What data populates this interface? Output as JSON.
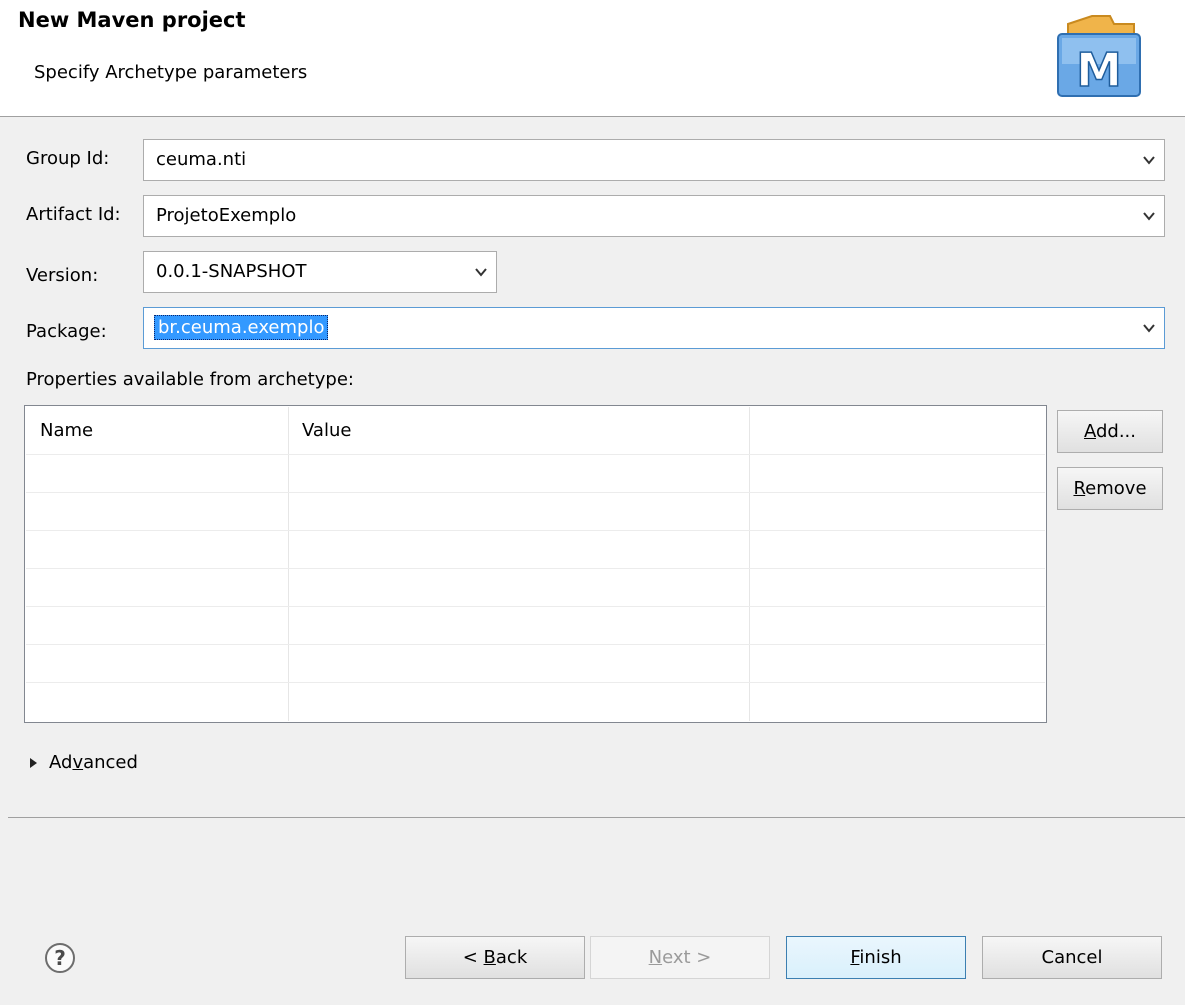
{
  "header": {
    "title": "New Maven project",
    "subtitle": "Specify Archetype parameters",
    "logo_letter": "M"
  },
  "form": {
    "group_id_label": "Group Id:",
    "group_id_value": "ceuma.nti",
    "artifact_id_label": "Artifact Id:",
    "artifact_id_value": "ProjetoExemplo",
    "version_label": "Version:",
    "version_value": "0.0.1-SNAPSHOT",
    "package_label": "Package:",
    "package_value": "br.ceuma.exemplo"
  },
  "properties": {
    "label": "Properties available from archetype:",
    "columns": [
      "Name",
      "Value",
      ""
    ],
    "rows": []
  },
  "side_buttons": {
    "add_mnemonic": "A",
    "add_rest": "dd...",
    "remove_mnemonic": "R",
    "remove_rest": "emove"
  },
  "advanced": {
    "pre": "Ad",
    "mnemonic": "v",
    "post": "anced"
  },
  "footer": {
    "back_pre": "< ",
    "back_mnemonic": "B",
    "back_post": "ack",
    "next_mnemonic": "N",
    "next_post": "ext >",
    "finish_mnemonic": "F",
    "finish_post": "inish",
    "cancel": "Cancel"
  },
  "colors": {
    "selection": "#3399ff",
    "focus_border": "#5b9bd5",
    "logo_blue": "#2f78c4",
    "logo_folder": "#f0b44a"
  }
}
